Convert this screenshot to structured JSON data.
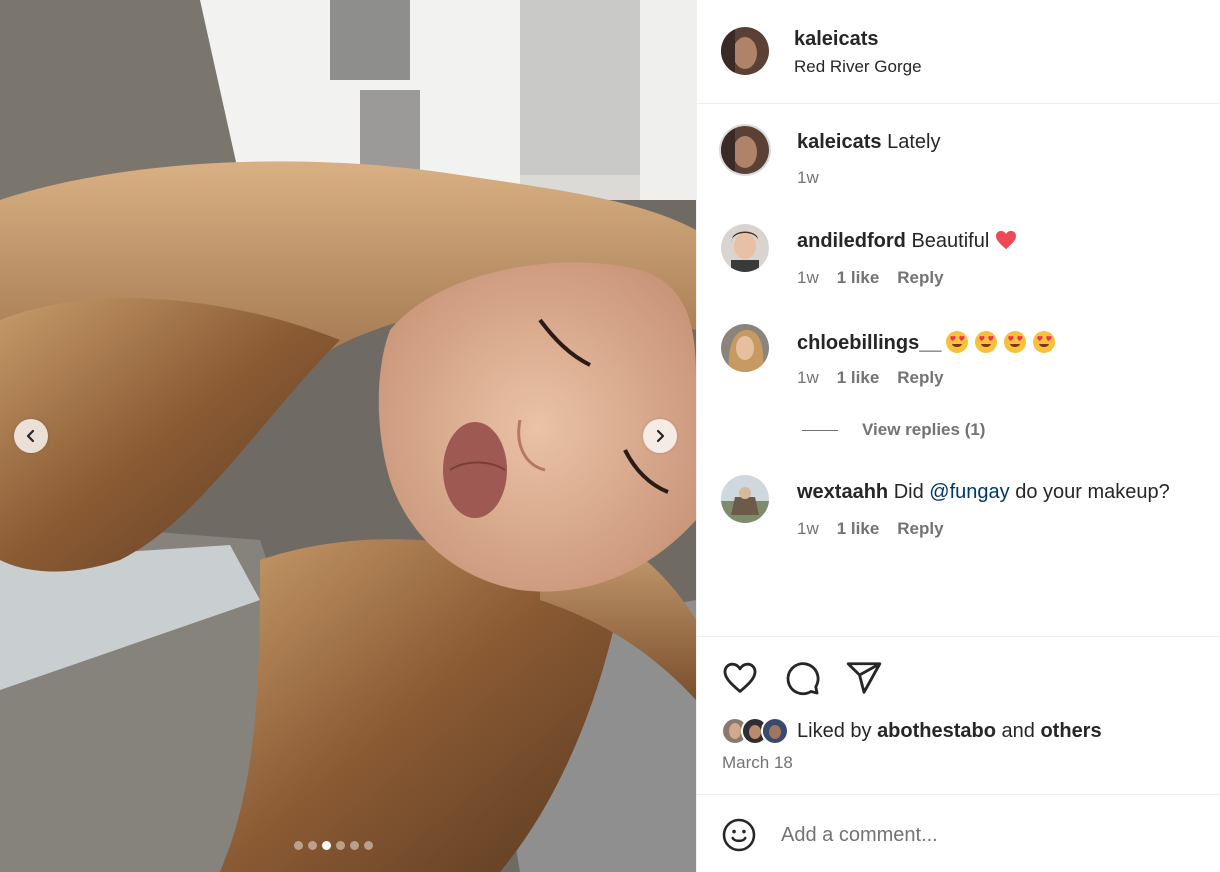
{
  "post": {
    "username": "kaleicats",
    "location": "Red River Gorge",
    "carousel": {
      "count": 6,
      "active_index": 2
    }
  },
  "caption": {
    "username": "kaleicats",
    "text": "Lately",
    "time": "1w"
  },
  "comments": [
    {
      "username": "andiledford",
      "text": "Beautiful",
      "emoji": "red-heart",
      "time": "1w",
      "likes": "1 like",
      "reply": "Reply"
    },
    {
      "username": "chloebillings__",
      "text": "",
      "emoji": "heart-eyes x4",
      "time": "1w",
      "likes": "1 like",
      "reply": "Reply"
    },
    {
      "username": "wextaahh",
      "text_before": "Did",
      "mention": "@fungay",
      "text_after": "do your makeup?",
      "time": "1w",
      "likes": "1 like",
      "reply": "Reply"
    }
  ],
  "view_replies": "View replies (1)",
  "likes": {
    "prefix": "Liked by",
    "user": "abothestabo",
    "and": "and",
    "others": "others"
  },
  "date": "March 18",
  "comment_box": {
    "placeholder": "Add a comment..."
  },
  "colors": {
    "text": "#262626",
    "secondary": "#737373",
    "mention": "#00376b",
    "heart": "#ed4956"
  }
}
